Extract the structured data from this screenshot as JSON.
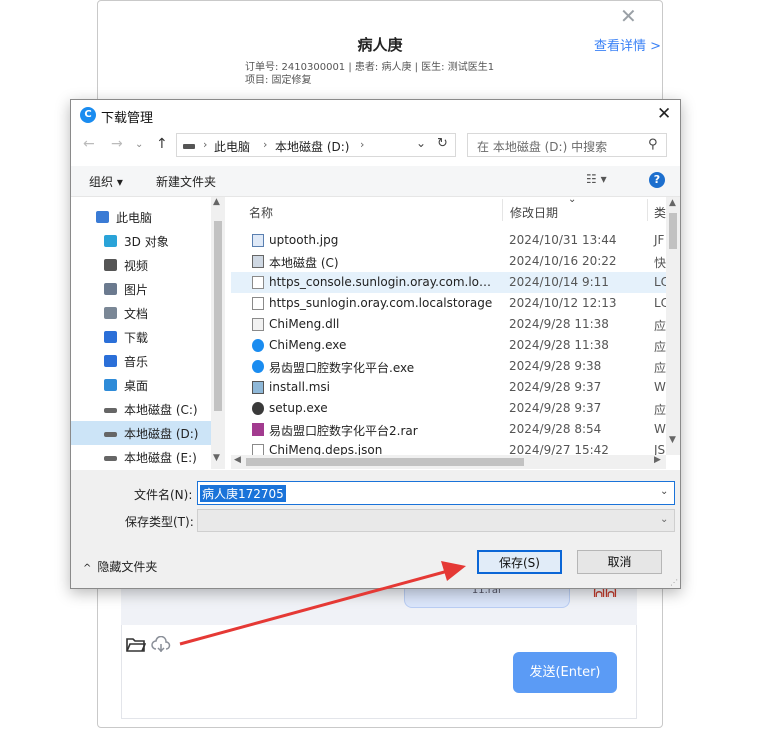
{
  "background_app": {
    "close_glyph": "✕",
    "patient_title": "病人庚",
    "details_link": "查看详情 >",
    "order_line": "订单号: 2410300001  |  患者:  病人庚  |  医生:  测试医生1",
    "project_line": "项目:  固定修复",
    "file_bubble_text": "11.rar",
    "send_button": "发送(Enter)"
  },
  "dialog": {
    "title": "下载管理",
    "close_glyph": "✕",
    "address": {
      "segments": [
        "此电脑",
        "本地磁盘 (D:)"
      ],
      "separator": "›"
    },
    "search_placeholder": "在 本地磁盘 (D:) 中搜索",
    "toolbar": {
      "organize": "组织 ▾",
      "new_folder": "新建文件夹",
      "help": "?"
    },
    "nav_items": [
      {
        "label": "此电脑",
        "icon": "computer-icon",
        "color": "#3a7bd5"
      },
      {
        "label": "3D 对象",
        "icon": "cube-icon",
        "color": "#2aa3d8"
      },
      {
        "label": "视频",
        "icon": "film-icon",
        "color": "#555555"
      },
      {
        "label": "图片",
        "icon": "picture-icon",
        "color": "#6b7a8f"
      },
      {
        "label": "文档",
        "icon": "document-icon",
        "color": "#7a8796"
      },
      {
        "label": "下载",
        "icon": "download-icon",
        "color": "#2b6fd8"
      },
      {
        "label": "音乐",
        "icon": "music-icon",
        "color": "#2b6fd8"
      },
      {
        "label": "桌面",
        "icon": "desktop-icon",
        "color": "#2e8bd8"
      },
      {
        "label": "本地磁盘 (C:)",
        "icon": "drive-icon",
        "color": "#666666"
      },
      {
        "label": "本地磁盘 (D:)",
        "icon": "drive-icon",
        "color": "#666666"
      },
      {
        "label": "本地磁盘 (E:)",
        "icon": "drive-icon",
        "color": "#666666"
      }
    ],
    "columns": [
      "名称",
      "修改日期",
      "类"
    ],
    "files": [
      {
        "name": "uptooth.jpg",
        "date": "2024/10/31 13:44",
        "type": "JF",
        "icon": "image-file-icon"
      },
      {
        "name": "本地磁盘 (C)",
        "date": "2024/10/16 20:22",
        "type": "快",
        "icon": "shortcut-drive-icon"
      },
      {
        "name": "https_console.sunlogin.oray.com.loca...",
        "date": "2024/10/14 9:11",
        "type": "LC",
        "icon": "blank-file-icon"
      },
      {
        "name": "https_sunlogin.oray.com.localstorage",
        "date": "2024/10/12 12:13",
        "type": "LC",
        "icon": "blank-file-icon"
      },
      {
        "name": "ChiMeng.dll",
        "date": "2024/9/28 11:38",
        "type": "应",
        "icon": "dll-file-icon"
      },
      {
        "name": "ChiMeng.exe",
        "date": "2024/9/28 11:38",
        "type": "应",
        "icon": "app-exe-icon"
      },
      {
        "name": "易齿盟口腔数字化平台.exe",
        "date": "2024/9/28 9:38",
        "type": "应",
        "icon": "app-exe-icon"
      },
      {
        "name": "install.msi",
        "date": "2024/9/28 9:37",
        "type": "W",
        "icon": "installer-icon"
      },
      {
        "name": "setup.exe",
        "date": "2024/9/28 9:37",
        "type": "应",
        "icon": "setup-disc-icon"
      },
      {
        "name": "易齿盟口腔数字化平台2.rar",
        "date": "2024/9/28 8:54",
        "type": "W",
        "icon": "rar-archive-icon"
      },
      {
        "name": "ChiMeng.deps.json",
        "date": "2024/9/27 15:42",
        "type": "JS",
        "icon": "blank-file-icon"
      }
    ],
    "filename_label": "文件名(N):",
    "filename_value": "病人庚172705",
    "filetype_label": "保存类型(T):",
    "filetype_value": "",
    "hide_folders": "隐藏文件夹",
    "save_button": "保存(S)",
    "cancel_button": "取消"
  },
  "colors": {
    "accent": "#1a73d9",
    "send_button": "#5b9bf5",
    "arrow": "#e53935",
    "selection": "#cce4f7"
  }
}
